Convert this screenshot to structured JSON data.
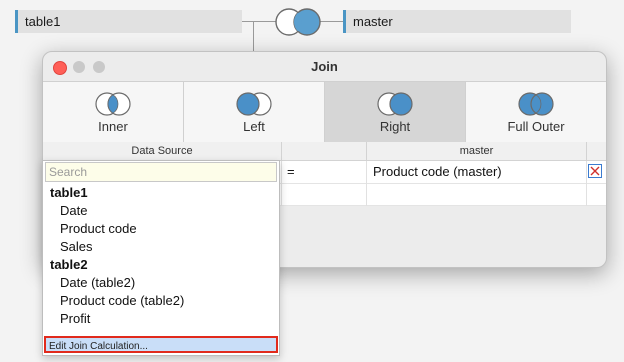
{
  "canvas": {
    "left_table": "table1",
    "right_table": "master"
  },
  "dialog": {
    "title": "Join",
    "join_types": [
      {
        "label": "Inner",
        "icon": "inner-join-icon",
        "selected": false
      },
      {
        "label": "Left",
        "icon": "left-join-icon",
        "selected": false
      },
      {
        "label": "Right",
        "icon": "right-join-icon",
        "selected": true
      },
      {
        "label": "Full Outer",
        "icon": "full-outer-join-icon",
        "selected": false
      }
    ],
    "grid": {
      "left_header": "Data Source",
      "right_header": "master",
      "operator": "=",
      "right_value": "Product code (master)"
    }
  },
  "dropdown": {
    "search_placeholder": "Search",
    "groups": [
      {
        "table": "table1",
        "fields": [
          "Date",
          "Product code",
          "Sales"
        ]
      },
      {
        "table": "table2",
        "fields": [
          "Date (table2)",
          "Product code (table2)",
          "Profit"
        ]
      }
    ],
    "footer_action": "Edit Join Calculation..."
  },
  "colors": {
    "venn_fill": "#4a90c8",
    "selected_tab": "#d6d6d6",
    "highlight": "#c9def8",
    "focus_border": "#e12a1c"
  }
}
